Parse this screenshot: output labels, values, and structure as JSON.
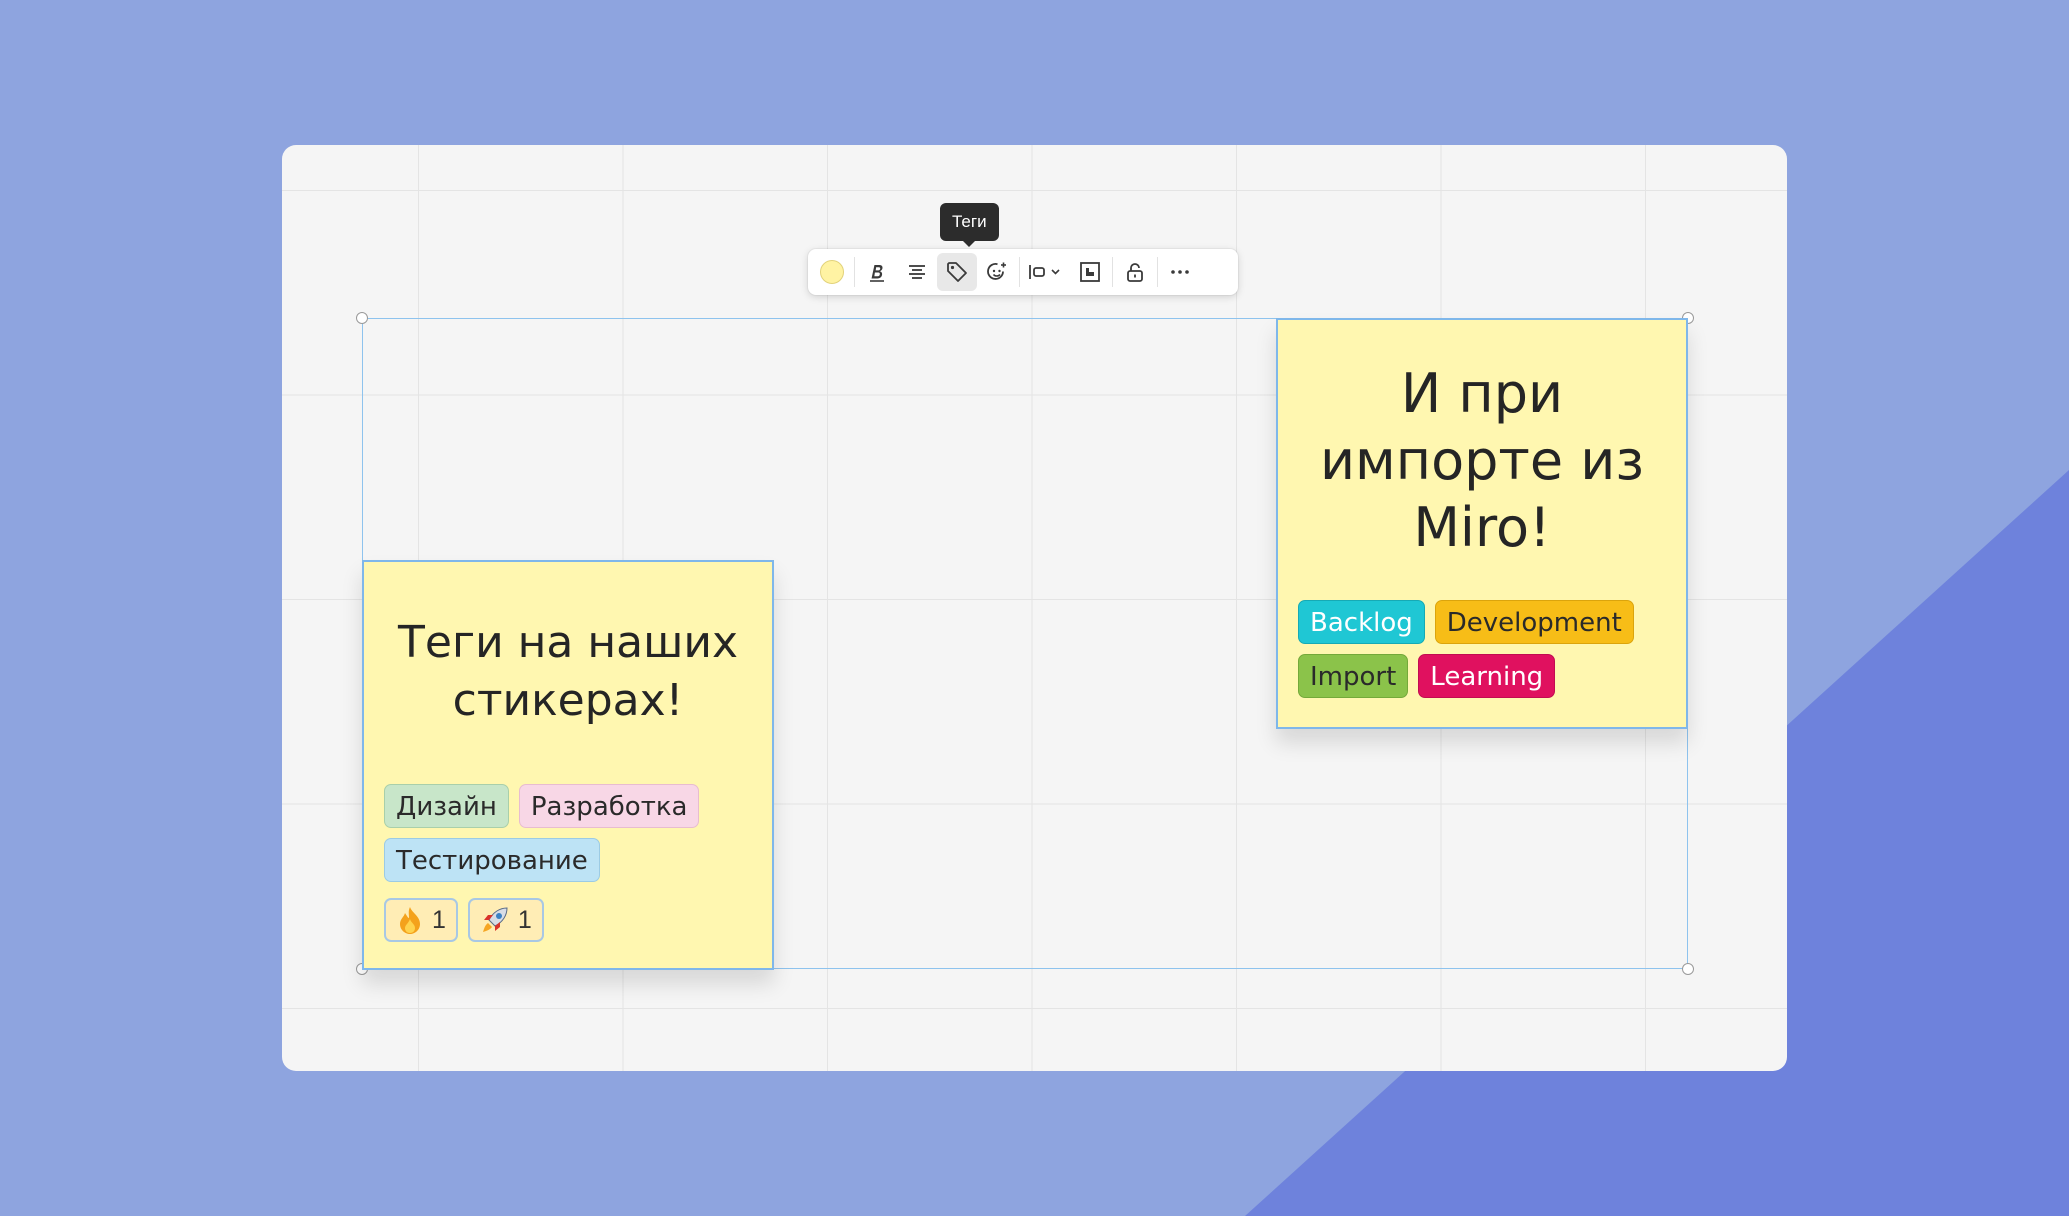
{
  "toolbar": {
    "tooltip": "Теги",
    "color_swatch": "#fff3a3",
    "icons": [
      "color-swatch-icon",
      "bold-icon",
      "align-center-icon",
      "tag-icon",
      "emoji-icon",
      "align-left-dropdown-icon",
      "frame-icon",
      "unlock-icon",
      "more-icon"
    ]
  },
  "sticky_left": {
    "text_line1": "Теги на наших",
    "text_line2": "стикерах!",
    "tags": [
      {
        "label": "Дизайн",
        "color": "#c8e6c9"
      },
      {
        "label": "Разработка",
        "color": "#f8d7e6"
      },
      {
        "label": "Тестирование",
        "color": "#bde3f5"
      }
    ],
    "reactions": [
      {
        "emoji": "🔥",
        "count": "1"
      },
      {
        "emoji": "🚀",
        "count": "1"
      }
    ]
  },
  "sticky_right": {
    "text_line1": "И при",
    "text_line2": "импорте из",
    "text_line3": "Miro!",
    "tags": [
      {
        "label": "Backlog",
        "color": "#1fc7d4"
      },
      {
        "label": "Development",
        "color": "#f7bd17"
      },
      {
        "label": "Import",
        "color": "#8bc34a"
      },
      {
        "label": "Learning",
        "color": "#e0115f"
      }
    ]
  },
  "colors": {
    "background": "#8ea4df",
    "board": "#f5f5f5",
    "sticky": "#fff7b0",
    "selection": "#8ec3ee"
  }
}
